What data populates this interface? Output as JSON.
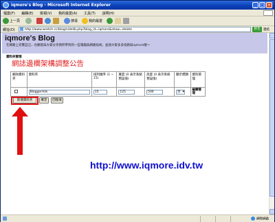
{
  "window": {
    "title": "iqmore's Blog - Microsoft Internet Explorer",
    "min": "_",
    "max": "□",
    "close": "×"
  },
  "menu": [
    "檔案(F)",
    "編輯(E)",
    "檢視(V)",
    "我的最愛(A)",
    "工具(T)",
    "說明(H)"
  ],
  "toolbar": {
    "back": "上一頁",
    "search": "搜尋",
    "favorites": "我的最愛"
  },
  "address": {
    "label": "網址(D)",
    "url": "http://www.wretch.cc/blog/sidelib.php?blog_id=iqmore&show=delete",
    "go": "移至",
    "links": "連結"
  },
  "blog": {
    "title": "iqmore's Blog",
    "description": "在網路上充實自己，也願意與大家分享我所學到的一些電腦與網路技術，並請大家多多指教與iqmore喔～"
  },
  "admin": {
    "section_label": "資料夾管理",
    "heading": "網誌邊欄架構調整公告"
  },
  "table": {
    "headers": {
      "delete": "刪除資料夾",
      "name": "資料夾",
      "order": "排列順序 (1 ~ 15)",
      "width": "寬度 (0 表示系統預設值)",
      "height": "高度 (0 表示系統預設值)",
      "show_title": "顯示標題",
      "manage": "資料管理"
    },
    "row": {
      "name": "BloggerAds",
      "order": "15",
      "width": "125",
      "height": "500",
      "show_title": "否",
      "manage": "編輯管理"
    }
  },
  "buttons": {
    "add": "新增資料夾",
    "confirm": "確定",
    "reset": "回復值"
  },
  "overlay": {
    "url": "http://www.iqmore.idv.tw"
  },
  "status": {
    "zone": "網際網路"
  },
  "colors": {
    "heading": "#e02020",
    "overlay_url": "#1010d0",
    "annotation": "#e01010",
    "header_bg": "#c7c7ea"
  }
}
